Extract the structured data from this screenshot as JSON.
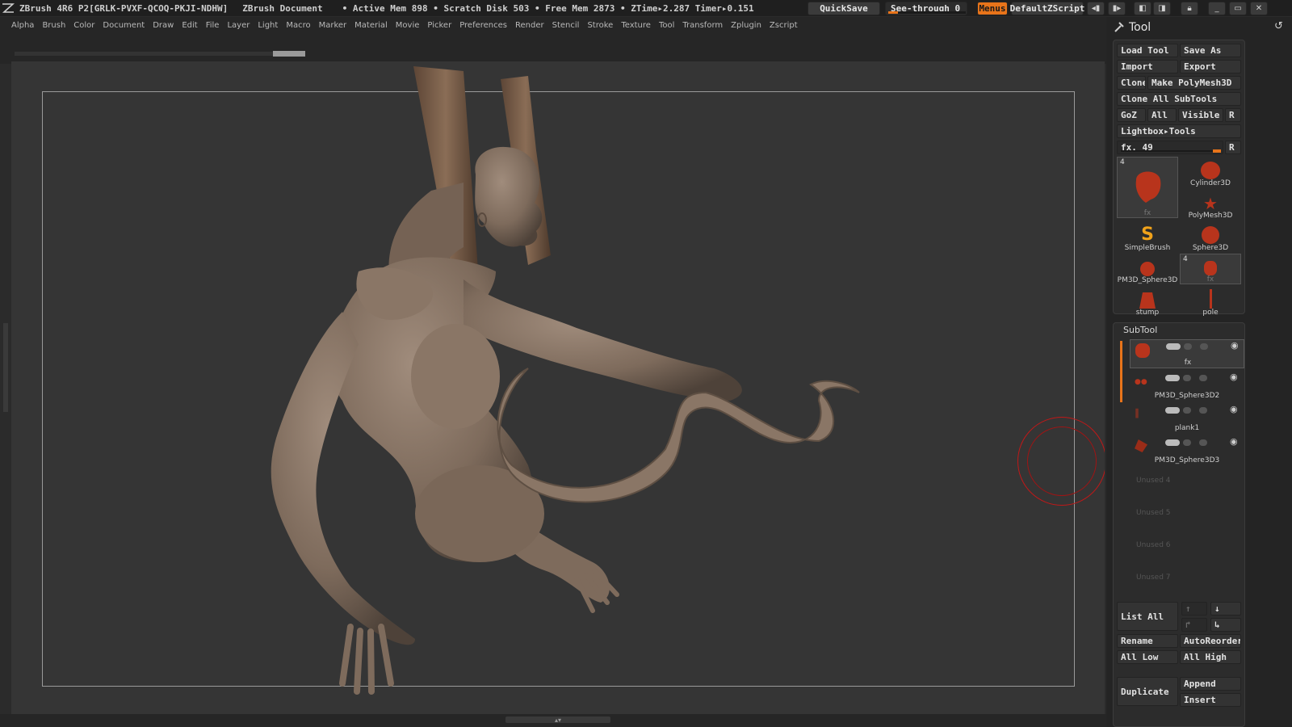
{
  "titlebar": {
    "app_title": "ZBrush 4R6 P2[GRLK-PVXF-QCOQ-PKJI-NDHW]",
    "document": "ZBrush Document",
    "stats": "• Active Mem 898 • Scratch Disk 503 • Free Mem 2873 • ZTime▸2.287 Timer▸0.151",
    "quicksave": "QuickSave",
    "seethrough": "See-through  0",
    "seethrough_value": 0,
    "menus": "Menus",
    "default_zscript": "DefaultZScript"
  },
  "menubar": [
    "Alpha",
    "Brush",
    "Color",
    "Document",
    "Draw",
    "Edit",
    "File",
    "Layer",
    "Light",
    "Macro",
    "Marker",
    "Material",
    "Movie",
    "Picker",
    "Preferences",
    "Render",
    "Stencil",
    "Stroke",
    "Texture",
    "Tool",
    "Transform",
    "Zplugin",
    "Zscript"
  ],
  "tool_panel": {
    "title": "Tool",
    "load_tool": "Load Tool",
    "save_as": "Save As",
    "import": "Import",
    "export": "Export",
    "clone": "Clone",
    "make_polymesh": "Make PolyMesh3D",
    "clone_all": "Clone  All  SubTools",
    "goz": "GoZ",
    "all": "All",
    "visible": "Visible",
    "r": "R",
    "lightbox_tools": "Lightbox▸Tools",
    "fx_label": "fx. 49",
    "fx_value": 49,
    "thumbs": [
      {
        "label": "fx",
        "count": "4"
      },
      {
        "label": "Cylinder3D"
      },
      {
        "label": "PolyMesh3D"
      },
      {
        "label": "SimpleBrush"
      },
      {
        "label": "Sphere3D"
      },
      {
        "label": "PM3D_Sphere3D"
      },
      {
        "label": "fx",
        "count": "4"
      },
      {
        "label": "stump"
      },
      {
        "label": "pole"
      }
    ]
  },
  "subtool": {
    "title": "SubTool",
    "items": [
      {
        "name": "fx"
      },
      {
        "name": "PM3D_Sphere3D2"
      },
      {
        "name": "plank1"
      },
      {
        "name": "PM3D_Sphere3D3"
      }
    ],
    "unused": [
      "Unused 4",
      "Unused 5",
      "Unused 6",
      "Unused 7"
    ],
    "list_all": "List  All",
    "rename": "Rename",
    "autoreorder": "AutoReorder",
    "all_low": "All Low",
    "all_high": "All High",
    "duplicate": "Duplicate",
    "append": "Append",
    "insert": "Insert"
  },
  "colors": {
    "accent": "#e8741a",
    "cursor_ring": "#c01818",
    "model": "#8a7666",
    "wood": "#7a5c48"
  }
}
